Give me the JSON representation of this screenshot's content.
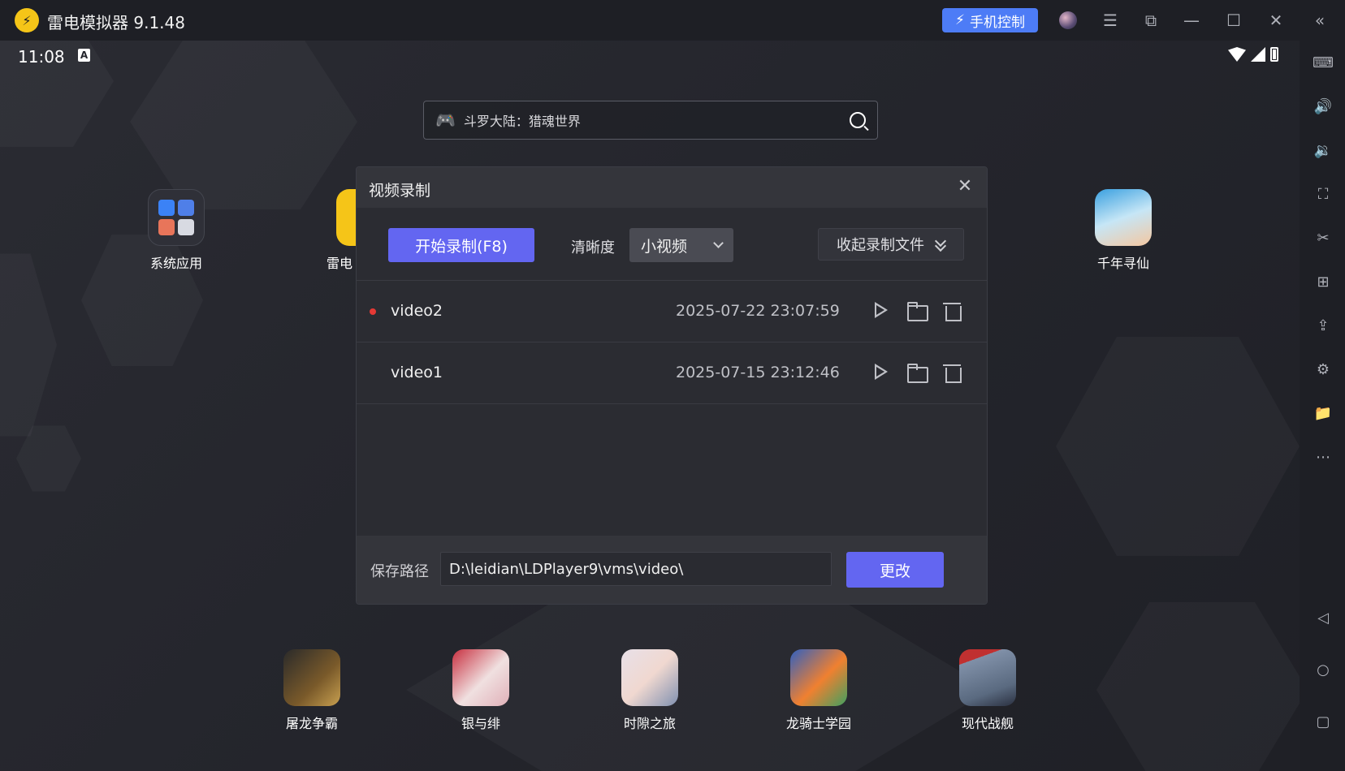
{
  "window": {
    "title": "雷电模拟器 9.1.48",
    "phone_control_label": "手机控制"
  },
  "status_bar": {
    "time": "11:08",
    "badge": "A"
  },
  "search": {
    "text": "斗罗大陆：猎魂世界"
  },
  "desktop_apps": [
    {
      "label": "系统应用"
    },
    {
      "label": "雷电"
    },
    {
      "label": "千年寻仙"
    }
  ],
  "dialog": {
    "title": "视频录制",
    "start_record_label": "开始录制(F8)",
    "quality_label": "清晰度",
    "quality_value": "小视频",
    "collapse_label": "收起录制文件",
    "recordings": [
      {
        "name": "video2",
        "time": "2025-07-22 23:07:59",
        "active": true
      },
      {
        "name": "video1",
        "time": "2025-07-15 23:12:46",
        "active": false
      }
    ],
    "save_path_label": "保存路径",
    "save_path_value": "D:\\leidian\\LDPlayer9\\vms\\video\\",
    "change_label": "更改"
  },
  "dock_apps": [
    {
      "label": "屠龙争霸"
    },
    {
      "label": "银与绯"
    },
    {
      "label": "时隙之旅"
    },
    {
      "label": "龙骑士学园"
    },
    {
      "label": "现代战舰"
    }
  ],
  "colors": {
    "accent": "#6366f1",
    "phone_control": "#4d7cf6",
    "record_dot": "#e53935",
    "logo": "#f5c518"
  }
}
